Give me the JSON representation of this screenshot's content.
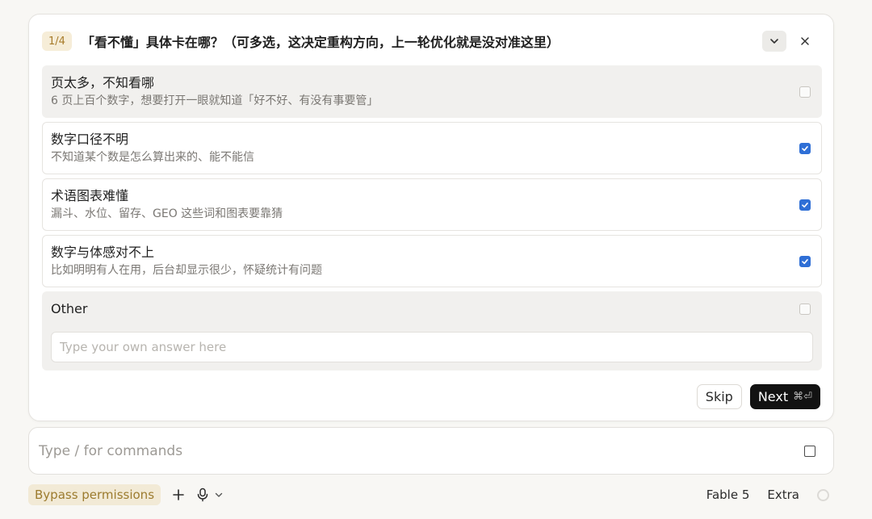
{
  "question": {
    "counter": "1/4",
    "title": "「看不懂」具体卡在哪？（可多选，这决定重构方向，上一轮优化就是没对准这里）",
    "options": [
      {
        "title": "页太多，不知看哪",
        "desc": "6 页上百个数字，想要打开一眼就知道「好不好、有没有事要管」",
        "checked": false
      },
      {
        "title": "数字口径不明",
        "desc": "不知道某个数是怎么算出来的、能不能信",
        "checked": true
      },
      {
        "title": "术语图表难懂",
        "desc": "漏斗、水位、留存、GEO 这些词和图表要靠猜",
        "checked": true
      },
      {
        "title": "数字与体感对不上",
        "desc": "比如明明有人在用，后台却显示很少，怀疑统计有问题",
        "checked": true
      }
    ],
    "other": {
      "label": "Other",
      "checked": false,
      "placeholder": "Type your own answer here"
    },
    "skip_label": "Skip",
    "next_label": "Next",
    "next_shortcut": "⌘⏎"
  },
  "command": {
    "placeholder": "Type / for commands"
  },
  "bottom": {
    "bypass_label": "Bypass permissions",
    "model_label": "Fable 5",
    "extra_label": "Extra"
  },
  "icons": {
    "collapse": "chevron-down-icon",
    "close": "close-icon",
    "plus": "plus-icon",
    "mic": "microphone-icon",
    "stop": "stop-icon"
  },
  "colors": {
    "accent_blue": "#2f6fd6",
    "counter_bg": "#f6edd8",
    "counter_text": "#a77b2a",
    "next_bg": "#121212"
  }
}
